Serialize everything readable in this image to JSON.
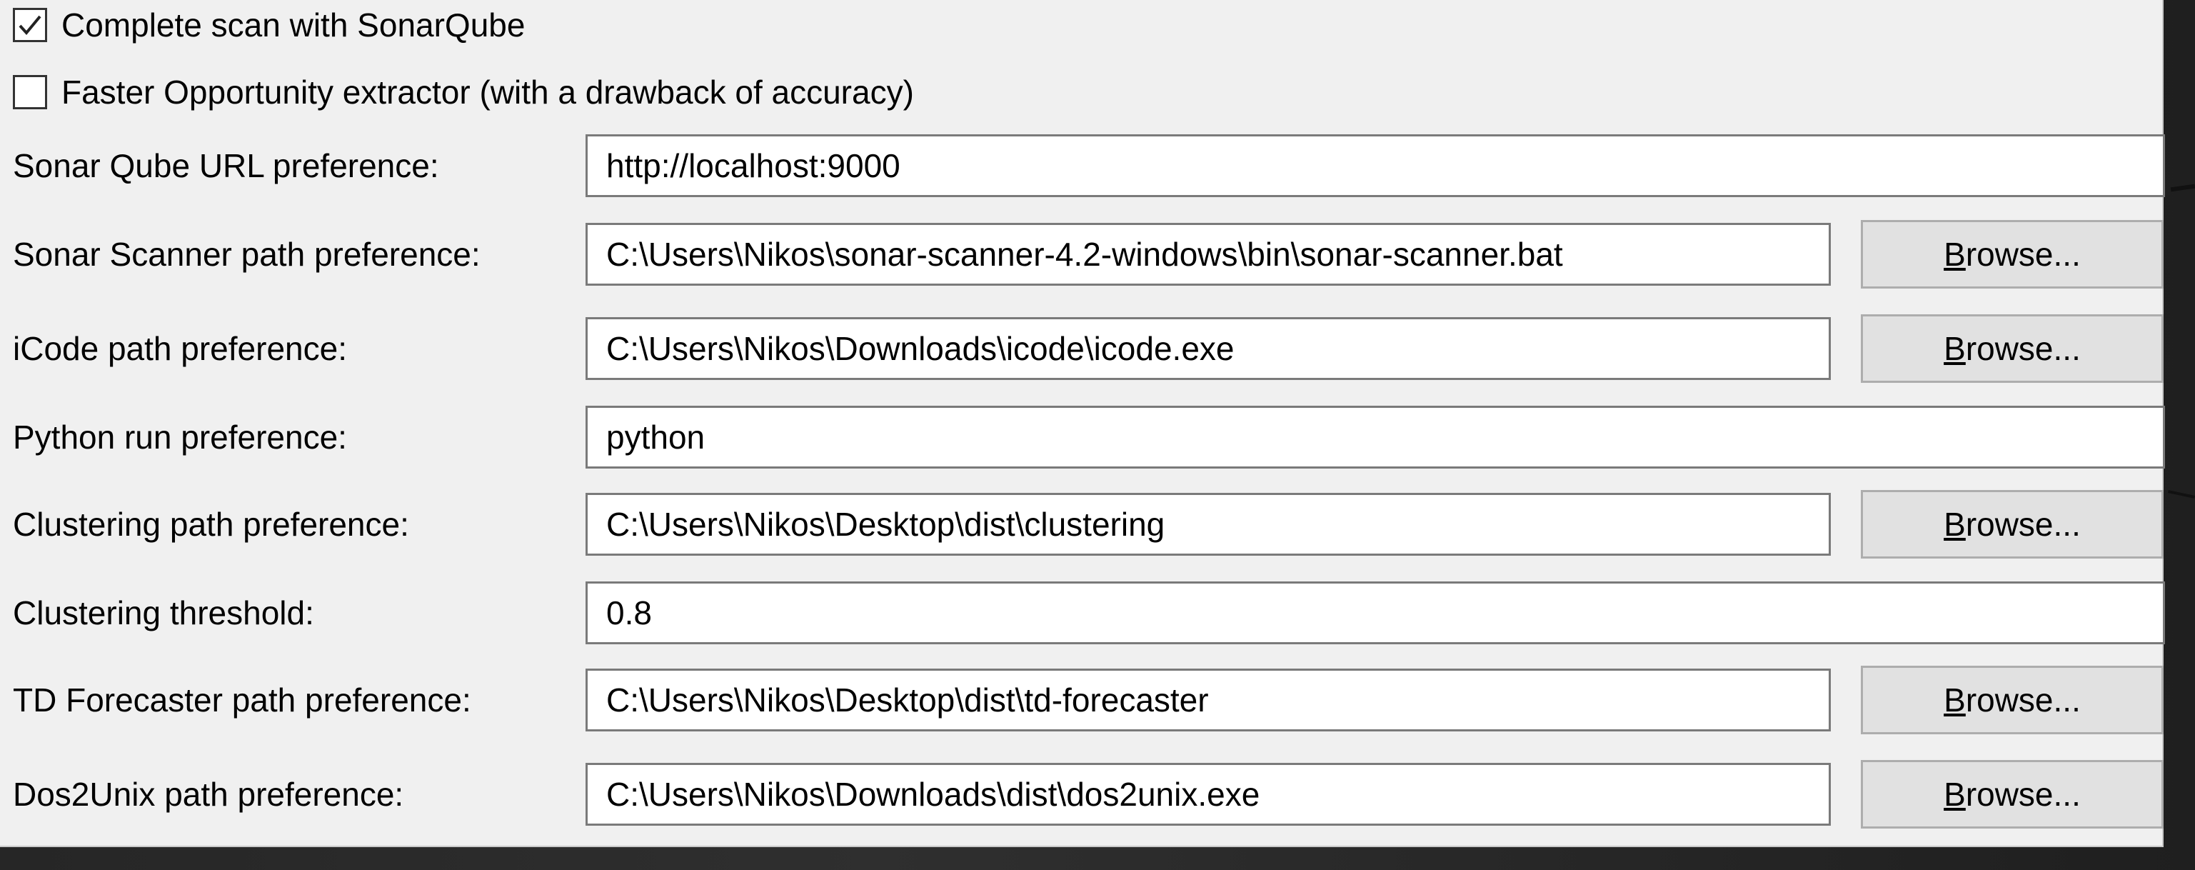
{
  "checkboxes": [
    {
      "label": "Complete scan with SonarQube",
      "checked": true
    },
    {
      "label": "Faster Opportunity extractor (with a drawback of accuracy)",
      "checked": false
    }
  ],
  "browse_button": {
    "mnemonic": "B",
    "rest": "rowse..."
  },
  "fields": [
    {
      "label": "Sonar Qube URL preference:",
      "value": "http://localhost:9000",
      "has_browse": false
    },
    {
      "label": "Sonar Scanner path preference:",
      "value": "C:\\Users\\Nikos\\sonar-scanner-4.2-windows\\bin\\sonar-scanner.bat",
      "has_browse": true
    },
    {
      "label": "iCode path preference:",
      "value": "C:\\Users\\Nikos\\Downloads\\icode\\icode.exe",
      "has_browse": true
    },
    {
      "label": "Python run preference:",
      "value": "python",
      "has_browse": false
    },
    {
      "label": "Clustering path preference:",
      "value": "C:\\Users\\Nikos\\Desktop\\dist\\clustering",
      "has_browse": true
    },
    {
      "label": "Clustering threshold:",
      "value": "0.8",
      "has_browse": false
    },
    {
      "label": "TD Forecaster path preference:",
      "value": "C:\\Users\\Nikos\\Desktop\\dist\\td-forecaster",
      "has_browse": true
    },
    {
      "label": "Dos2Unix path preference:",
      "value": "C:\\Users\\Nikos\\Downloads\\dist\\dos2unix.exe",
      "has_browse": true
    }
  ]
}
